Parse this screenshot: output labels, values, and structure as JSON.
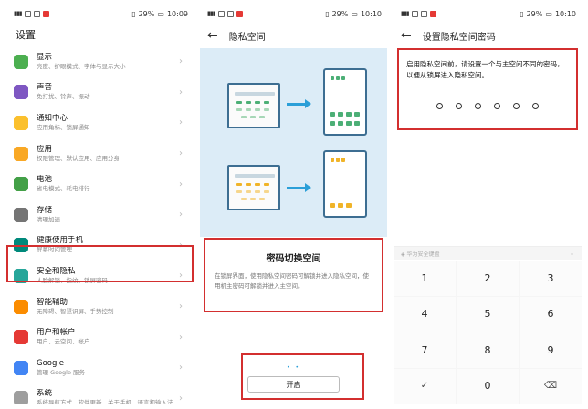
{
  "panel1": {
    "status_time": "10:09",
    "battery": "29%",
    "title": "设置",
    "items": [
      {
        "title": "显示",
        "sub": "亮度、护眼模式、字体与显示大小",
        "icon_color": "#4caf50",
        "icon": "display-icon"
      },
      {
        "title": "声音",
        "sub": "免打扰、铃声、振动",
        "icon_color": "#7e57c2",
        "icon": "sound-icon"
      },
      {
        "title": "通知中心",
        "sub": "应用角标、锁屏通知",
        "icon_color": "#fbc02d",
        "icon": "bell-icon"
      },
      {
        "title": "应用",
        "sub": "权限管理、默认应用、应用分身",
        "icon_color": "#f9a825",
        "icon": "apps-icon"
      },
      {
        "title": "电池",
        "sub": "省电模式、耗电排行",
        "icon_color": "#43a047",
        "icon": "battery-icon"
      },
      {
        "title": "存储",
        "sub": "清理加速",
        "icon_color": "#757575",
        "icon": "storage-icon"
      },
      {
        "title": "健康使用手机",
        "sub": "屏幕时间管理",
        "icon_color": "#00897b",
        "icon": "hourglass-icon"
      },
      {
        "title": "安全和隐私",
        "sub": "人脸解锁、指纹、锁屏密码",
        "icon_color": "#26a69a",
        "icon": "shield-icon"
      },
      {
        "title": "智能辅助",
        "sub": "无障碍、智慧识屏、手势控制",
        "icon_color": "#fb8c00",
        "icon": "assist-icon"
      },
      {
        "title": "用户和帐户",
        "sub": "用户、云空间、帐户",
        "icon_color": "#e53935",
        "icon": "user-icon"
      },
      {
        "title": "Google",
        "sub": "管理 Google 服务",
        "icon_color": "#4285f4",
        "icon": "google-icon"
      },
      {
        "title": "系统",
        "sub": "系统导航方式、软件更新、关于手机、语言和输入法",
        "icon_color": "#9e9e9e",
        "icon": "system-icon"
      }
    ]
  },
  "panel2": {
    "status_time": "10:10",
    "battery": "29%",
    "title": "隐私空间",
    "card_title": "密码切换空间",
    "card_desc": "在锁屏界面，使用隐私空间密码可解锁并进入隐私空间，使用机主密码可解锁并进入主空间。",
    "button_label": "开启",
    "pager_dots": "• •"
  },
  "panel3": {
    "status_time": "10:10",
    "battery": "29%",
    "title": "设置隐私空间密码",
    "message": "启用隐私空间前，请设置一个与主空间不同的密码，以便从锁屏进入隐私空间。",
    "keyboard_label": "华为安全键盘",
    "keys": [
      "1",
      "2",
      "3",
      "4",
      "5",
      "6",
      "7",
      "8",
      "9",
      "✓",
      "0",
      "⌫"
    ]
  }
}
